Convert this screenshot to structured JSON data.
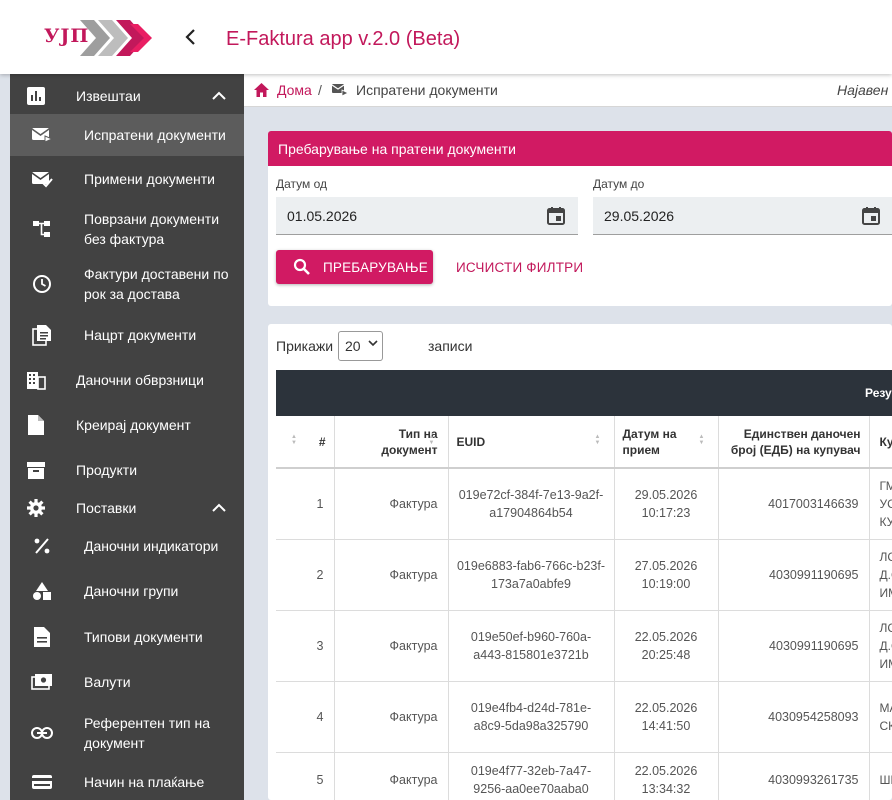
{
  "header": {
    "logo_text": "УЈП",
    "app_title": "E-Faktura app v.2.0 (Beta)",
    "back_icon": "chevron-left-icon"
  },
  "sidebar": {
    "items": [
      {
        "label": "Извештаи",
        "icon": "bar-chart-icon",
        "expanded": true
      },
      {
        "label": "Испратени документи",
        "icon": "mail-send-icon",
        "active": true
      },
      {
        "label": "Примени документи",
        "icon": "mail-check-icon"
      },
      {
        "label": "Поврзани документи\nбез фактура",
        "icon": "hierarchy-icon"
      },
      {
        "label": "Фактури доставени по\nрок за достава",
        "icon": "clock-icon"
      },
      {
        "label": "Нацрт документи",
        "icon": "documents-icon"
      },
      {
        "label": "Даночни обврзници",
        "icon": "building-icon"
      },
      {
        "label": "Креирај документ",
        "icon": "file-icon"
      },
      {
        "label": "Продукти",
        "icon": "archive-icon"
      },
      {
        "label": "Поставки",
        "icon": "gear-icon",
        "expanded": true
      },
      {
        "label": "Даночни индикатори",
        "icon": "percent-icon"
      },
      {
        "label": "Даночни групи",
        "icon": "shapes-icon"
      },
      {
        "label": "Типови документи",
        "icon": "description-icon"
      },
      {
        "label": "Валути",
        "icon": "money-icon"
      },
      {
        "label": "Референтен тип на\nдокумент",
        "icon": "link-icon"
      },
      {
        "label": "Начин на плаќање",
        "icon": "credit-card-icon"
      }
    ]
  },
  "breadcrumb": {
    "home": "Дома",
    "separator": "/",
    "current": "Испратени документи",
    "user": "Најавен"
  },
  "search": {
    "title": "Пребарување на пратени документи",
    "date_from_label": "Датум од",
    "date_from_value": "01.05.2026",
    "date_to_label": "Датум до",
    "date_to_value": "29.05.2026",
    "search_button": "ПРЕБАРУВАЊЕ",
    "clear_button": "ИСЧИСТИ ФИЛТРИ"
  },
  "table": {
    "show_label": "Прикажи",
    "page_size": "20",
    "records_label": "записи",
    "results_header": "Резу",
    "columns": [
      "#",
      "Тип на\nдокумент",
      "EUID",
      "Датум на\nприем",
      "Единствен даночен\nброј (ЕДБ) на купувач",
      "Ку"
    ],
    "rows": [
      {
        "num": "1",
        "type": "Фактура",
        "euid": "019e72cf-384f-7e13-9a2f-a17904864b54",
        "date": "29.05.2026\n10:17:23",
        "tax": "4017003146639",
        "buyer": "ГМ\nУС\nКУ"
      },
      {
        "num": "2",
        "type": "Фактура",
        "euid": "019e6883-fab6-766c-b23f-173a7a0abfe9",
        "date": "27.05.2026\n10:19:00",
        "tax": "4030991190695",
        "buyer": "ЛС\nД.С\nИМ"
      },
      {
        "num": "3",
        "type": "Фактура",
        "euid": "019e50ef-b960-760a-a443-815801e3721b",
        "date": "22.05.2026\n20:25:48",
        "tax": "4030991190695",
        "buyer": "ЛС\nД.С\nИМ"
      },
      {
        "num": "4",
        "type": "Фактура",
        "euid": "019e4fb4-d24d-781e-a8c9-5da98a325790",
        "date": "22.05.2026\n14:41:50",
        "tax": "4030954258093",
        "buyer": "МА\nСК"
      },
      {
        "num": "5",
        "type": "Фактура",
        "euid": "019e4f77-32eb-7a47-9256-aa0ee70aaba0",
        "date": "22.05.2026\n13:34:32",
        "tax": "4030993261735",
        "buyer": "ШП"
      }
    ]
  },
  "colors": {
    "accent": "#d11a63",
    "sidebar_bg": "#424242",
    "table_header_dark": "#2c333b"
  }
}
